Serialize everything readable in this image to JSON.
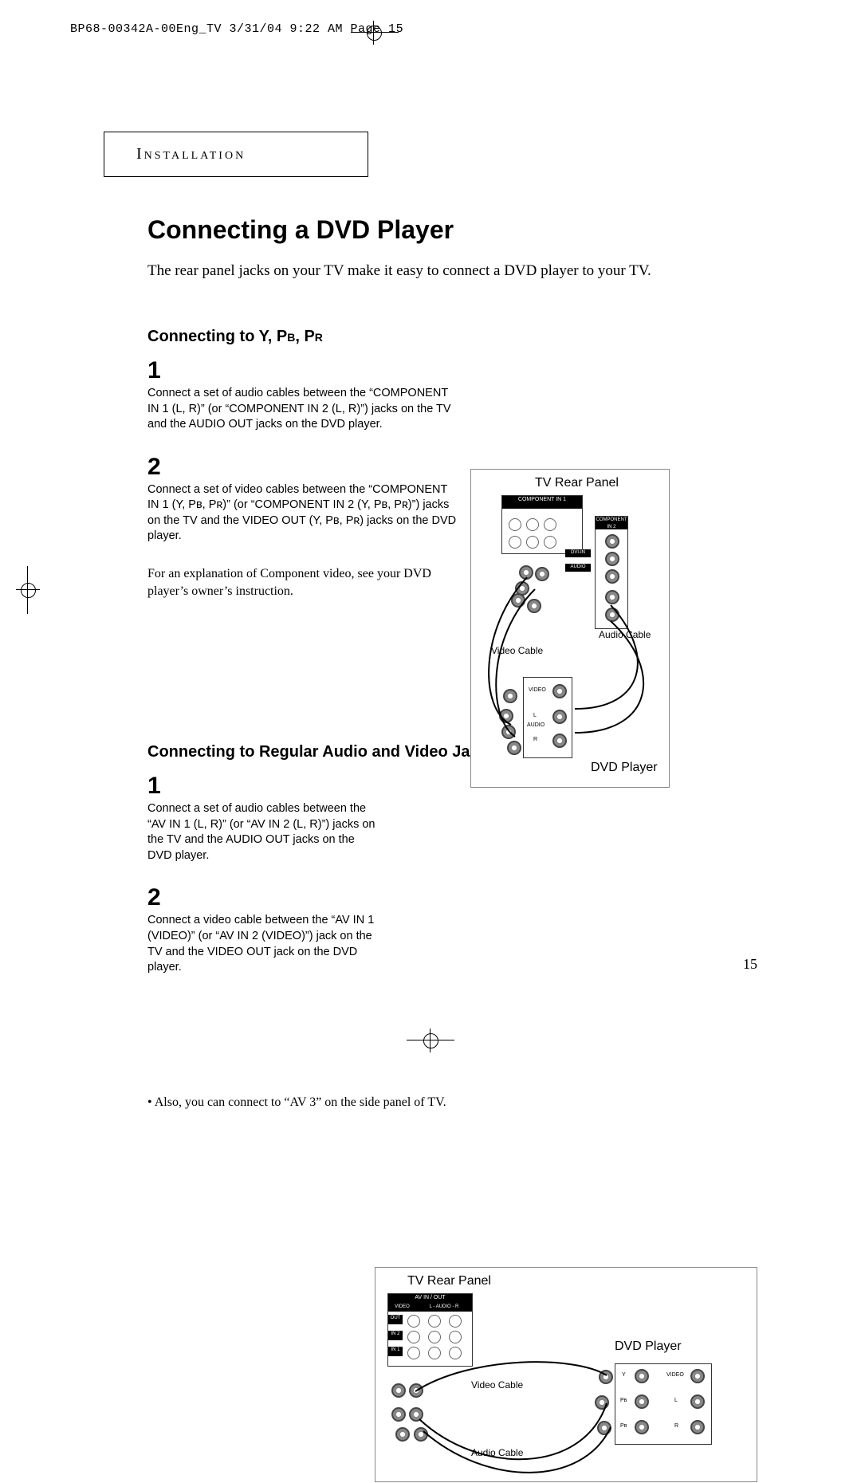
{
  "meta": {
    "header_line": "BP68-00342A-00Eng_TV  3/31/04  9:22 AM  Page 15"
  },
  "section": {
    "label": "Installation"
  },
  "title": "Connecting a DVD Player",
  "intro": "The rear panel jacks on your TV make it easy to connect a DVD player to your TV.",
  "part1": {
    "heading_prefix": "Connecting to Y, ",
    "heading_pb": "Pb",
    "heading_sep": ", ",
    "heading_pr": "Pr",
    "step1_no": "1",
    "step1_text": "Connect a set of audio cables between the “COMPONENT IN 1 (L, R)” (or “COMPONENT IN 2 (L, R)”) jacks on the TV and the AUDIO OUT jacks on the DVD player.",
    "step2_no": "2",
    "step2_text": "Connect a set of video cables between the “COMPONENT IN 1 (Y, Pʙ, Pʀ)” (or “COMPONENT IN 2 (Y, Pʙ, Pʀ)”) jacks on the TV and the VIDEO OUT (Y, Pʙ, Pʀ) jacks on the DVD player.",
    "note": "For an explanation of Component video, see your DVD player’s owner’s instruction.",
    "diag": {
      "tv_label": "TV Rear Panel",
      "component_in_1": "COMPONENT IN 1",
      "component_in_2": "COMPONENT IN 2",
      "dvi_in": "DVI-IN",
      "audio": "AUDIO",
      "video_cable": "Video Cable",
      "audio_cable": "Audio Cable",
      "video": "VIDEO",
      "l": "L",
      "r": "R",
      "audio_small": "AUDIO",
      "dvd_label": "DVD Player"
    }
  },
  "part2": {
    "heading": "Connecting to Regular Audio and Video Jacks",
    "step1_no": "1",
    "step1_text": "Connect a set of audio cables between the “AV IN 1 (L, R)” (or “AV IN 2 (L, R)”) jacks on the TV and the AUDIO OUT jacks on the DVD player.",
    "step2_no": "2",
    "step2_text": "Connect a video cable between the “AV IN 1 (VIDEO)” (or “AV IN 2 (VIDEO)”) jack on the TV and the VIDEO OUT jack on the DVD player.",
    "diag": {
      "tv_label": "TV Rear Panel",
      "av_in_out": "AV IN / OUT",
      "video": "VIDEO",
      "l_audio_r": "L - AUDIO - R",
      "out": "OUT",
      "in2": "IN 2",
      "in1": "IN 1",
      "video_cable": "Video Cable",
      "audio_cable": "Audio Cable",
      "dvd_label": "DVD Player",
      "y": "Y",
      "pb": "Pʙ",
      "pr": "Pʀ",
      "video_small": "VIDEO",
      "l": "L",
      "r": "R"
    }
  },
  "footnote": "• Also, you can connect to “AV 3” on the side panel of TV.",
  "page_number": "15"
}
